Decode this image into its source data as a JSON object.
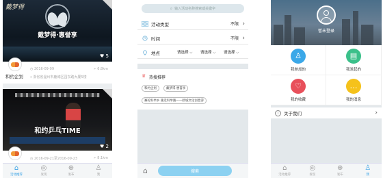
{
  "screen1": {
    "cards": [
      {
        "calligraphy": "戴梦得",
        "title": "戴梦得·惠誉享",
        "likes": "5",
        "org": "和约企划",
        "date": "2016-09-09",
        "views": "6.8km",
        "address": "浙省省温州市鹿城区园东路大厦5楼",
        "banner_title": "",
        "colors": {
          "like_heart": "#ffffff"
        }
      },
      {
        "title": "和约乒乓TIME",
        "likes": "2",
        "date": "2016-09-21至2016-09-23",
        "views": "8.1km"
      }
    ],
    "tabs": [
      {
        "icon": "home-icon",
        "glyph": "⌂",
        "label": "活动推荐"
      },
      {
        "icon": "compass-icon",
        "glyph": "◎",
        "label": "发现"
      },
      {
        "icon": "plus-icon",
        "glyph": "⊕",
        "label": "发布"
      },
      {
        "icon": "user-icon",
        "glyph": "♙",
        "label": "我"
      }
    ]
  },
  "screen2": {
    "search_placeholder": "输入活动名称搜索或关键字",
    "filters": [
      {
        "icon": "category-icon",
        "label": "活动类型",
        "value": "不限"
      },
      {
        "icon": "clock-icon",
        "label": "时间",
        "value": "不限"
      },
      {
        "icon": "location-icon",
        "label": "地点",
        "picks": [
          "请选择",
          "请选择",
          "请选择"
        ]
      }
    ],
    "hot_title": "热搜推荐",
    "tags": [
      "和约企划",
      "戴梦得·惠誉享",
      "赛轮科举乡 重走科举路——鹤城文化创意游"
    ],
    "search_button": "搜索"
  },
  "screen3": {
    "login": "暂未登录",
    "grid": [
      {
        "icon": "people-icon",
        "label": "我参加的",
        "color": "#3ba8e8"
      },
      {
        "icon": "document-icon",
        "label": "我发起的",
        "color": "#3bc08a"
      },
      {
        "icon": "heart-icon",
        "label": "我的收藏",
        "color": "#e8505b"
      },
      {
        "icon": "chat-icon",
        "label": "我的消息",
        "color": "#f5c21b"
      }
    ],
    "about": "关于我们",
    "tabs": [
      {
        "icon": "home-icon",
        "glyph": "⌂",
        "label": "活动推荐"
      },
      {
        "icon": "compass-icon",
        "glyph": "◎",
        "label": "发现"
      },
      {
        "icon": "plus-icon",
        "glyph": "⊕",
        "label": "发布"
      },
      {
        "icon": "user-icon",
        "glyph": "♙",
        "label": "我"
      }
    ]
  }
}
